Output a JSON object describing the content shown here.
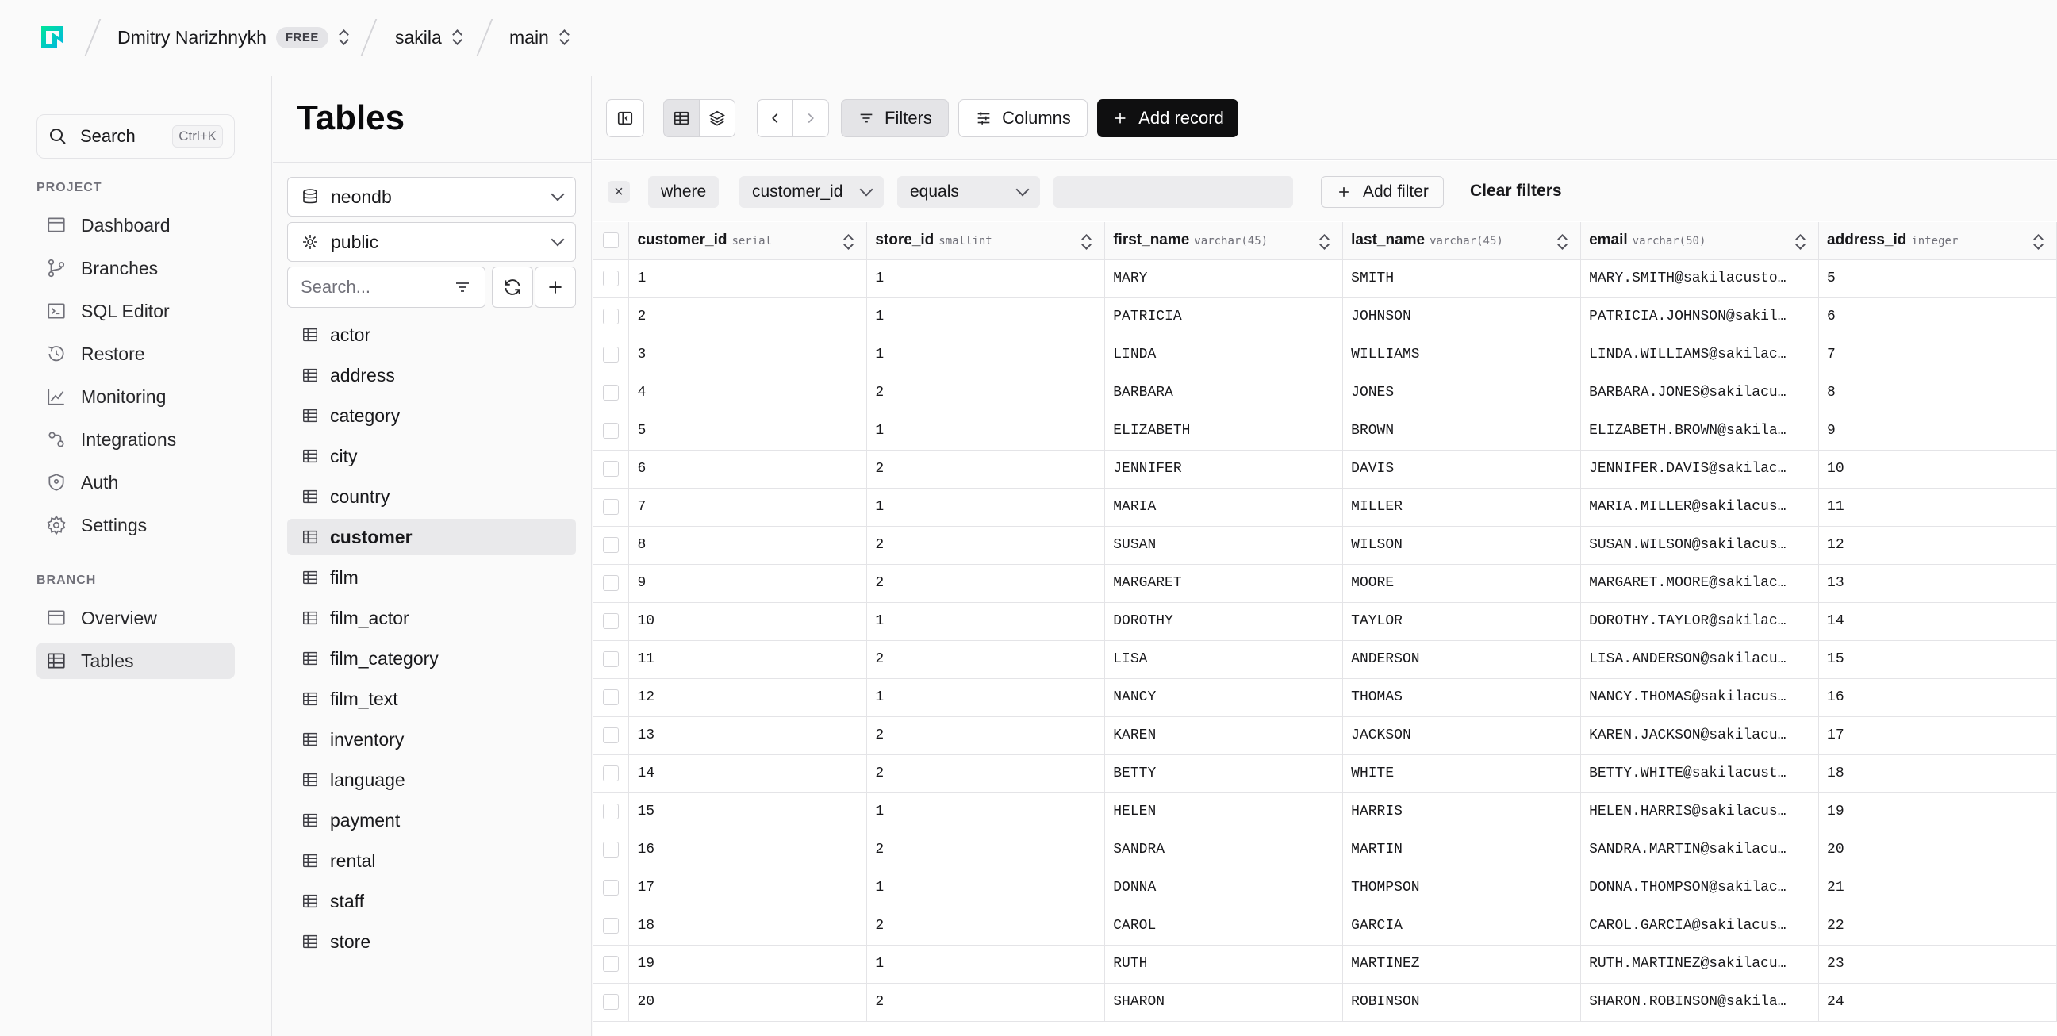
{
  "topbar": {
    "user": "Dmitry Narizhnykh",
    "plan_badge": "FREE",
    "project": "sakila",
    "branch": "main"
  },
  "nav": {
    "search_label": "Search",
    "search_shortcut": "Ctrl+K",
    "project_header": "PROJECT",
    "project_items": [
      "Dashboard",
      "Branches",
      "SQL Editor",
      "Restore",
      "Monitoring",
      "Integrations",
      "Auth",
      "Settings"
    ],
    "branch_header": "BRANCH",
    "branch_items": [
      "Overview",
      "Tables"
    ]
  },
  "tables_panel": {
    "title": "Tables",
    "database": "neondb",
    "schema": "public",
    "search_placeholder": "Search...",
    "tables": [
      "actor",
      "address",
      "category",
      "city",
      "country",
      "customer",
      "film",
      "film_actor",
      "film_category",
      "film_text",
      "inventory",
      "language",
      "payment",
      "rental",
      "staff",
      "store"
    ],
    "selected": "customer"
  },
  "toolbar": {
    "filters_label": "Filters",
    "columns_label": "Columns",
    "add_record_label": "Add record"
  },
  "filter": {
    "where_label": "where",
    "column": "customer_id",
    "operator": "equals",
    "value": "",
    "add_filter_label": "Add filter",
    "clear_filters_label": "Clear filters"
  },
  "grid": {
    "columns": [
      {
        "name": "customer_id",
        "type": "serial"
      },
      {
        "name": "store_id",
        "type": "smallint"
      },
      {
        "name": "first_name",
        "type": "varchar(45)"
      },
      {
        "name": "last_name",
        "type": "varchar(45)"
      },
      {
        "name": "email",
        "type": "varchar(50)"
      },
      {
        "name": "address_id",
        "type": "integer"
      }
    ],
    "rows": [
      [
        "1",
        "1",
        "MARY",
        "SMITH",
        "MARY.SMITH@sakilacusto…",
        "5"
      ],
      [
        "2",
        "1",
        "PATRICIA",
        "JOHNSON",
        "PATRICIA.JOHNSON@sakil…",
        "6"
      ],
      [
        "3",
        "1",
        "LINDA",
        "WILLIAMS",
        "LINDA.WILLIAMS@sakilac…",
        "7"
      ],
      [
        "4",
        "2",
        "BARBARA",
        "JONES",
        "BARBARA.JONES@sakilacu…",
        "8"
      ],
      [
        "5",
        "1",
        "ELIZABETH",
        "BROWN",
        "ELIZABETH.BROWN@sakila…",
        "9"
      ],
      [
        "6",
        "2",
        "JENNIFER",
        "DAVIS",
        "JENNIFER.DAVIS@sakilac…",
        "10"
      ],
      [
        "7",
        "1",
        "MARIA",
        "MILLER",
        "MARIA.MILLER@sakilacus…",
        "11"
      ],
      [
        "8",
        "2",
        "SUSAN",
        "WILSON",
        "SUSAN.WILSON@sakilacus…",
        "12"
      ],
      [
        "9",
        "2",
        "MARGARET",
        "MOORE",
        "MARGARET.MOORE@sakilac…",
        "13"
      ],
      [
        "10",
        "1",
        "DOROTHY",
        "TAYLOR",
        "DOROTHY.TAYLOR@sakilac…",
        "14"
      ],
      [
        "11",
        "2",
        "LISA",
        "ANDERSON",
        "LISA.ANDERSON@sakilacu…",
        "15"
      ],
      [
        "12",
        "1",
        "NANCY",
        "THOMAS",
        "NANCY.THOMAS@sakilacus…",
        "16"
      ],
      [
        "13",
        "2",
        "KAREN",
        "JACKSON",
        "KAREN.JACKSON@sakilacu…",
        "17"
      ],
      [
        "14",
        "2",
        "BETTY",
        "WHITE",
        "BETTY.WHITE@sakilacust…",
        "18"
      ],
      [
        "15",
        "1",
        "HELEN",
        "HARRIS",
        "HELEN.HARRIS@sakilacus…",
        "19"
      ],
      [
        "16",
        "2",
        "SANDRA",
        "MARTIN",
        "SANDRA.MARTIN@sakilacu…",
        "20"
      ],
      [
        "17",
        "1",
        "DONNA",
        "THOMPSON",
        "DONNA.THOMPSON@sakilac…",
        "21"
      ],
      [
        "18",
        "2",
        "CAROL",
        "GARCIA",
        "CAROL.GARCIA@sakilacus…",
        "22"
      ],
      [
        "19",
        "1",
        "RUTH",
        "MARTINEZ",
        "RUTH.MARTINEZ@sakilacu…",
        "23"
      ],
      [
        "20",
        "2",
        "SHARON",
        "ROBINSON",
        "SHARON.ROBINSON@sakila…",
        "24"
      ]
    ]
  },
  "colors": {
    "accent": "#00e599",
    "primary_button": "#0f0f10",
    "active_bg": "#e9e9eb"
  }
}
